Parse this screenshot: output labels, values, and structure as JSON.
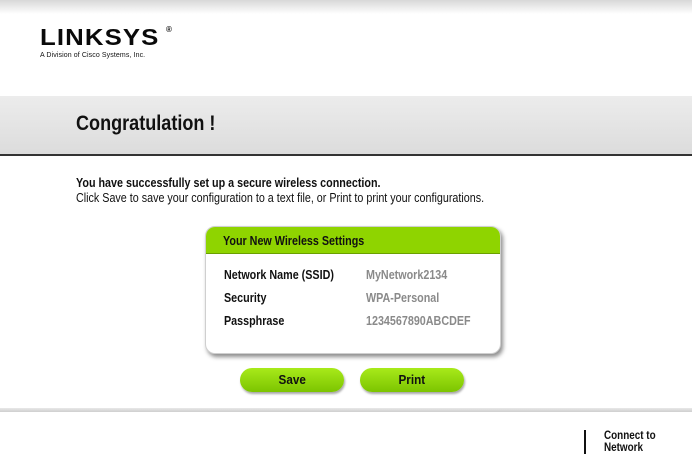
{
  "header": {
    "logo_text": "LINKSYS",
    "logo_mark": "®",
    "tagline": "A Division of Cisco Systems, Inc."
  },
  "page": {
    "title": "Congratulation !",
    "message_bold": "You have successfully set up a secure wireless connection.",
    "message": "Click Save to save your configuration to a text file, or Print to print your configurations."
  },
  "settings": {
    "heading": "Your New Wireless Settings",
    "rows": [
      {
        "label": "Network Name (SSID)",
        "value": "MyNetwork2134"
      },
      {
        "label": "Security",
        "value": "WPA-Personal"
      },
      {
        "label": "Passphrase",
        "value": "1234567890ABCDEF"
      }
    ]
  },
  "buttons": {
    "save": "Save",
    "print": "Print"
  },
  "footer": {
    "step_line1": "Connect to",
    "step_line2": "Network"
  },
  "colors": {
    "accent_green": "#8fd400",
    "value_gray": "#8a8a8a"
  }
}
